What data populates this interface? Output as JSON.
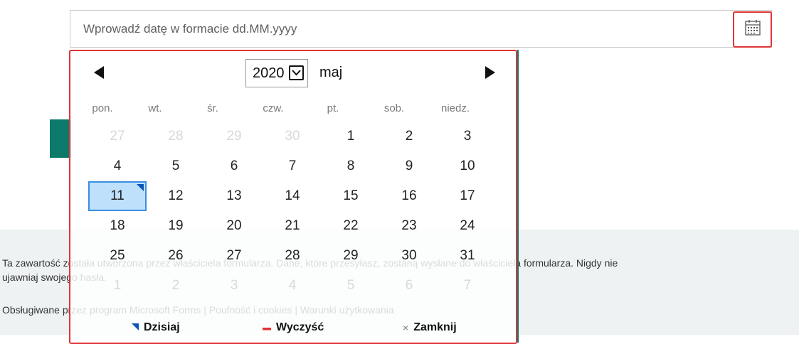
{
  "date_input": {
    "placeholder": "Wprowadź datę w formacie dd.MM.yyyy"
  },
  "calendar": {
    "year": "2020",
    "month": "maj",
    "weekdays": [
      "pon.",
      "wt.",
      "śr.",
      "czw.",
      "pt.",
      "sob.",
      "niedz."
    ],
    "weeks": [
      [
        "27",
        "28",
        "29",
        "30",
        "1",
        "2",
        "3"
      ],
      [
        "4",
        "5",
        "6",
        "7",
        "8",
        "9",
        "10"
      ],
      [
        "11",
        "12",
        "13",
        "14",
        "15",
        "16",
        "17"
      ],
      [
        "18",
        "19",
        "20",
        "21",
        "22",
        "23",
        "24"
      ],
      [
        "25",
        "26",
        "27",
        "28",
        "29",
        "30",
        "31"
      ],
      [
        "1",
        "2",
        "3",
        "4",
        "5",
        "6",
        "7"
      ]
    ],
    "selected_day": "11",
    "actions": {
      "today": "Dzisiaj",
      "clear": "Wyczyść",
      "close": "Zamknij"
    }
  },
  "footer": {
    "line1a": "Ta zawartość została utworzona przez właściciela formularza. Dane, które przesyłasz, zostaną wysłane do właściciela formularza. Nigdy nie",
    "line1b": "ujawniaj swojego hasła.",
    "line2": "Obsługiwane przez program Microsoft Forms | Poufność i cookies | Warunki użytkowania"
  },
  "colors": {
    "accent_red": "#e03535",
    "teal": "#0b7a6b",
    "selected_bg": "#bfe0fb",
    "today_marker": "#0a56b8"
  }
}
